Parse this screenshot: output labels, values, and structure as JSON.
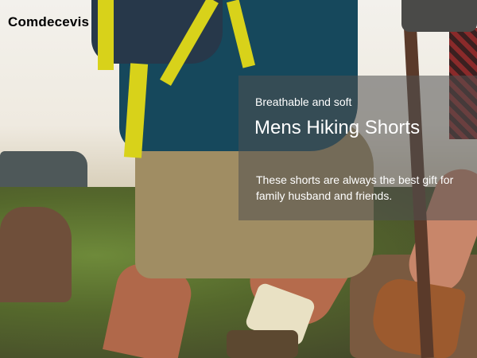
{
  "brand": {
    "name": "Comdecevis"
  },
  "hero": {
    "subtitle": "Breathable and soft",
    "title": "Mens Hiking Shorts",
    "description": "These shorts are always the best gift for family husband and friends."
  },
  "colors": {
    "overlay": "#505050",
    "text": "#ffffff",
    "brand_text": "#000000"
  }
}
